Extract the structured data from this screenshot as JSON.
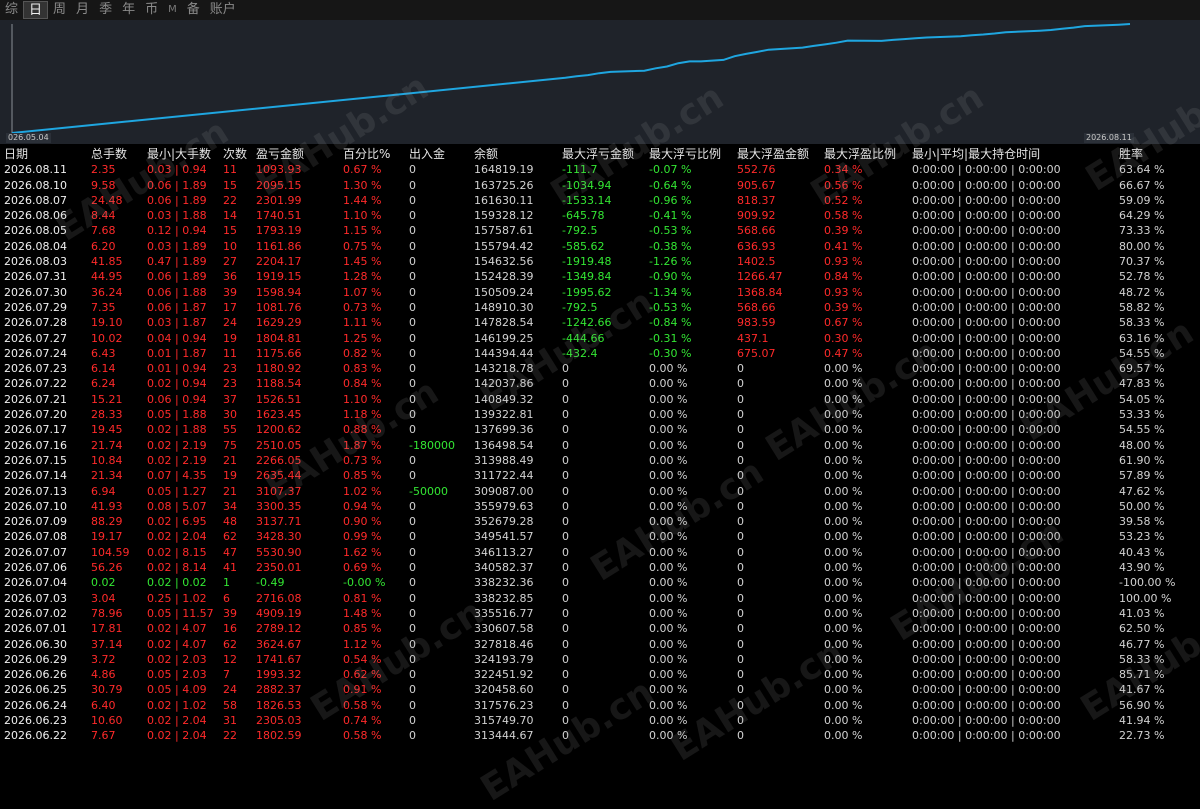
{
  "tabs": [
    "综",
    "日",
    "周",
    "月",
    "季",
    "年",
    "币",
    "M",
    "备",
    "账户"
  ],
  "active_tab": "日",
  "chart": {
    "start_date": "026.05.04",
    "end_date": "2026.08.11",
    "line_color": "#1fa6e0",
    "series": [
      {
        "date": "2026.05.04",
        "balance": 230000
      },
      {
        "date": "2026.06.22",
        "balance": 313444.67
      },
      {
        "date": "2026.06.23",
        "balance": 315749.7
      },
      {
        "date": "2026.06.24",
        "balance": 317576.23
      },
      {
        "date": "2026.06.25",
        "balance": 320458.6
      },
      {
        "date": "2026.06.26",
        "balance": 322451.92
      },
      {
        "date": "2026.06.29",
        "balance": 324193.79
      },
      {
        "date": "2026.06.30",
        "balance": 327818.46
      },
      {
        "date": "2026.07.01",
        "balance": 330607.58
      },
      {
        "date": "2026.07.02",
        "balance": 335516.77
      },
      {
        "date": "2026.07.03",
        "balance": 338232.85
      },
      {
        "date": "2026.07.04",
        "balance": 338232.36
      },
      {
        "date": "2026.07.06",
        "balance": 340582.37
      },
      {
        "date": "2026.07.07",
        "balance": 346113.27
      },
      {
        "date": "2026.07.08",
        "balance": 349541.57
      },
      {
        "date": "2026.07.09",
        "balance": 352679.28
      },
      {
        "date": "2026.07.10",
        "balance": 355979.63
      },
      {
        "date": "2026.07.13",
        "balance": 359087.0
      },
      {
        "date": "2026.07.14",
        "balance": 361722.44
      },
      {
        "date": "2026.07.15",
        "balance": 363988.49
      },
      {
        "date": "2026.07.16",
        "balance": 366498.54
      },
      {
        "date": "2026.07.17",
        "balance": 369699.36
      },
      {
        "date": "2026.07.20",
        "balance": 369322.81
      },
      {
        "date": "2026.07.21",
        "balance": 370849.32
      },
      {
        "date": "2026.07.22",
        "balance": 372037.86
      },
      {
        "date": "2026.07.23",
        "balance": 373218.78
      },
      {
        "date": "2026.07.24",
        "balance": 374394.44
      },
      {
        "date": "2026.07.27",
        "balance": 376199.25
      },
      {
        "date": "2026.07.28",
        "balance": 377828.54
      },
      {
        "date": "2026.07.29",
        "balance": 378910.3
      },
      {
        "date": "2026.07.30",
        "balance": 380509.24
      },
      {
        "date": "2026.07.31",
        "balance": 382428.39
      },
      {
        "date": "2026.08.03",
        "balance": 384632.56
      },
      {
        "date": "2026.08.04",
        "balance": 385794.42
      },
      {
        "date": "2026.08.05",
        "balance": 387587.61
      },
      {
        "date": "2026.08.06",
        "balance": 389328.12
      },
      {
        "date": "2026.08.07",
        "balance": 391630.11
      },
      {
        "date": "2026.08.10",
        "balance": 393725.26
      },
      {
        "date": "2026.08.11",
        "balance": 394819.19
      }
    ]
  },
  "watermark": "EAHub.cn",
  "headers": [
    "日期",
    "总手数",
    "最小|大手数",
    "次数",
    "盈亏金额",
    "百分比%",
    "出入金",
    "余额",
    "最大浮亏金额",
    "最大浮亏比例",
    "最大浮盈金额",
    "最大浮盈比例",
    "最小|平均|最大持仓时间",
    "胜率"
  ],
  "rows": [
    {
      "date": "2026.08.11",
      "lots": "2.35",
      "minmax": "0.03 | 0.94",
      "count": "11",
      "pnl": "1093.93",
      "pct": "0.67 %",
      "flow": "0",
      "balance": "164819.19",
      "maxdd_amt": "-111.7",
      "maxdd_pct": "-0.07 %",
      "maxfp_amt": "552.76",
      "maxfp_pct": "0.34 %",
      "hold": "0:00:00 | 0:00:00 | 0:00:00",
      "win": "63.64 %"
    },
    {
      "date": "2026.08.10",
      "lots": "9.58",
      "minmax": "0.06 | 1.89",
      "count": "15",
      "pnl": "2095.15",
      "pct": "1.30 %",
      "flow": "0",
      "balance": "163725.26",
      "maxdd_amt": "-1034.94",
      "maxdd_pct": "-0.64 %",
      "maxfp_amt": "905.67",
      "maxfp_pct": "0.56 %",
      "hold": "0:00:00 | 0:00:00 | 0:00:00",
      "win": "66.67 %"
    },
    {
      "date": "2026.08.07",
      "lots": "24.48",
      "minmax": "0.06 | 1.89",
      "count": "22",
      "pnl": "2301.99",
      "pct": "1.44 %",
      "flow": "0",
      "balance": "161630.11",
      "maxdd_amt": "-1533.14",
      "maxdd_pct": "-0.96 %",
      "maxfp_amt": "818.37",
      "maxfp_pct": "0.52 %",
      "hold": "0:00:00 | 0:00:00 | 0:00:00",
      "win": "59.09 %"
    },
    {
      "date": "2026.08.06",
      "lots": "8.44",
      "minmax": "0.03 | 1.88",
      "count": "14",
      "pnl": "1740.51",
      "pct": "1.10 %",
      "flow": "0",
      "balance": "159328.12",
      "maxdd_amt": "-645.78",
      "maxdd_pct": "-0.41 %",
      "maxfp_amt": "909.92",
      "maxfp_pct": "0.58 %",
      "hold": "0:00:00 | 0:00:00 | 0:00:00",
      "win": "64.29 %"
    },
    {
      "date": "2026.08.05",
      "lots": "7.68",
      "minmax": "0.12 | 0.94",
      "count": "15",
      "pnl": "1793.19",
      "pct": "1.15 %",
      "flow": "0",
      "balance": "157587.61",
      "maxdd_amt": "-792.5",
      "maxdd_pct": "-0.53 %",
      "maxfp_amt": "568.66",
      "maxfp_pct": "0.39 %",
      "hold": "0:00:00 | 0:00:00 | 0:00:00",
      "win": "73.33 %"
    },
    {
      "date": "2026.08.04",
      "lots": "6.20",
      "minmax": "0.03 | 1.89",
      "count": "10",
      "pnl": "1161.86",
      "pct": "0.75 %",
      "flow": "0",
      "balance": "155794.42",
      "maxdd_amt": "-585.62",
      "maxdd_pct": "-0.38 %",
      "maxfp_amt": "636.93",
      "maxfp_pct": "0.41 %",
      "hold": "0:00:00 | 0:00:00 | 0:00:00",
      "win": "80.00 %"
    },
    {
      "date": "2026.08.03",
      "lots": "41.85",
      "minmax": "0.47 | 1.89",
      "count": "27",
      "pnl": "2204.17",
      "pct": "1.45 %",
      "flow": "0",
      "balance": "154632.56",
      "maxdd_amt": "-1919.48",
      "maxdd_pct": "-1.26 %",
      "maxfp_amt": "1402.5",
      "maxfp_pct": "0.93 %",
      "hold": "0:00:00 | 0:00:00 | 0:00:00",
      "win": "70.37 %"
    },
    {
      "date": "2026.07.31",
      "lots": "44.95",
      "minmax": "0.06 | 1.89",
      "count": "36",
      "pnl": "1919.15",
      "pct": "1.28 %",
      "flow": "0",
      "balance": "152428.39",
      "maxdd_amt": "-1349.84",
      "maxdd_pct": "-0.90 %",
      "maxfp_amt": "1266.47",
      "maxfp_pct": "0.84 %",
      "hold": "0:00:00 | 0:00:00 | 0:00:00",
      "win": "52.78 %"
    },
    {
      "date": "2026.07.30",
      "lots": "36.24",
      "minmax": "0.06 | 1.88",
      "count": "39",
      "pnl": "1598.94",
      "pct": "1.07 %",
      "flow": "0",
      "balance": "150509.24",
      "maxdd_amt": "-1995.62",
      "maxdd_pct": "-1.34 %",
      "maxfp_amt": "1368.84",
      "maxfp_pct": "0.93 %",
      "hold": "0:00:00 | 0:00:00 | 0:00:00",
      "win": "48.72 %"
    },
    {
      "date": "2026.07.29",
      "lots": "7.35",
      "minmax": "0.06 | 1.87",
      "count": "17",
      "pnl": "1081.76",
      "pct": "0.73 %",
      "flow": "0",
      "balance": "148910.30",
      "maxdd_amt": "-792.5",
      "maxdd_pct": "-0.53 %",
      "maxfp_amt": "568.66",
      "maxfp_pct": "0.39 %",
      "hold": "0:00:00 | 0:00:00 | 0:00:00",
      "win": "58.82 %"
    },
    {
      "date": "2026.07.28",
      "lots": "19.10",
      "minmax": "0.03 | 1.87",
      "count": "24",
      "pnl": "1629.29",
      "pct": "1.11 %",
      "flow": "0",
      "balance": "147828.54",
      "maxdd_amt": "-1242.66",
      "maxdd_pct": "-0.84 %",
      "maxfp_amt": "983.59",
      "maxfp_pct": "0.67 %",
      "hold": "0:00:00 | 0:00:00 | 0:00:00",
      "win": "58.33 %"
    },
    {
      "date": "2026.07.27",
      "lots": "10.02",
      "minmax": "0.04 | 0.94",
      "count": "19",
      "pnl": "1804.81",
      "pct": "1.25 %",
      "flow": "0",
      "balance": "146199.25",
      "maxdd_amt": "-444.66",
      "maxdd_pct": "-0.31 %",
      "maxfp_amt": "437.1",
      "maxfp_pct": "0.30 %",
      "hold": "0:00:00 | 0:00:00 | 0:00:00",
      "win": "63.16 %"
    },
    {
      "date": "2026.07.24",
      "lots": "6.43",
      "minmax": "0.01 | 1.87",
      "count": "11",
      "pnl": "1175.66",
      "pct": "0.82 %",
      "flow": "0",
      "balance": "144394.44",
      "maxdd_amt": "-432.4",
      "maxdd_pct": "-0.30 %",
      "maxfp_amt": "675.07",
      "maxfp_pct": "0.47 %",
      "hold": "0:00:00 | 0:00:00 | 0:00:00",
      "win": "54.55 %"
    },
    {
      "date": "2026.07.23",
      "lots": "6.14",
      "minmax": "0.01 | 0.94",
      "count": "23",
      "pnl": "1180.92",
      "pct": "0.83 %",
      "flow": "0",
      "balance": "143218.78",
      "maxdd_amt": "0",
      "maxdd_pct": "0.00 %",
      "maxfp_amt": "0",
      "maxfp_pct": "0.00 %",
      "hold": "0:00:00 | 0:00:00 | 0:00:00",
      "win": "69.57 %"
    },
    {
      "date": "2026.07.22",
      "lots": "6.24",
      "minmax": "0.02 | 0.94",
      "count": "23",
      "pnl": "1188.54",
      "pct": "0.84 %",
      "flow": "0",
      "balance": "142037.86",
      "maxdd_amt": "0",
      "maxdd_pct": "0.00 %",
      "maxfp_amt": "0",
      "maxfp_pct": "0.00 %",
      "hold": "0:00:00 | 0:00:00 | 0:00:00",
      "win": "47.83 %"
    },
    {
      "date": "2026.07.21",
      "lots": "15.21",
      "minmax": "0.06 | 0.94",
      "count": "37",
      "pnl": "1526.51",
      "pct": "1.10 %",
      "flow": "0",
      "balance": "140849.32",
      "maxdd_amt": "0",
      "maxdd_pct": "0.00 %",
      "maxfp_amt": "0",
      "maxfp_pct": "0.00 %",
      "hold": "0:00:00 | 0:00:00 | 0:00:00",
      "win": "54.05 %"
    },
    {
      "date": "2026.07.20",
      "lots": "28.33",
      "minmax": "0.05 | 1.88",
      "count": "30",
      "pnl": "1623.45",
      "pct": "1.18 %",
      "flow": "0",
      "balance": "139322.81",
      "maxdd_amt": "0",
      "maxdd_pct": "0.00 %",
      "maxfp_amt": "0",
      "maxfp_pct": "0.00 %",
      "hold": "0:00:00 | 0:00:00 | 0:00:00",
      "win": "53.33 %"
    },
    {
      "date": "2026.07.17",
      "lots": "19.45",
      "minmax": "0.02 | 1.88",
      "count": "55",
      "pnl": "1200.62",
      "pct": "0.88 %",
      "flow": "0",
      "balance": "137699.36",
      "maxdd_amt": "0",
      "maxdd_pct": "0.00 %",
      "maxfp_amt": "0",
      "maxfp_pct": "0.00 %",
      "hold": "0:00:00 | 0:00:00 | 0:00:00",
      "win": "54.55 %"
    },
    {
      "date": "2026.07.16",
      "lots": "21.74",
      "minmax": "0.02 | 2.19",
      "count": "75",
      "pnl": "2510.05",
      "pct": "1.87 %",
      "flow": "-180000",
      "balance": "136498.54",
      "maxdd_amt": "0",
      "maxdd_pct": "0.00 %",
      "maxfp_amt": "0",
      "maxfp_pct": "0.00 %",
      "hold": "0:00:00 | 0:00:00 | 0:00:00",
      "win": "48.00 %"
    },
    {
      "date": "2026.07.15",
      "lots": "10.84",
      "minmax": "0.02 | 2.19",
      "count": "21",
      "pnl": "2266.05",
      "pct": "0.73 %",
      "flow": "0",
      "balance": "313988.49",
      "maxdd_amt": "0",
      "maxdd_pct": "0.00 %",
      "maxfp_amt": "0",
      "maxfp_pct": "0.00 %",
      "hold": "0:00:00 | 0:00:00 | 0:00:00",
      "win": "61.90 %"
    },
    {
      "date": "2026.07.14",
      "lots": "21.34",
      "minmax": "0.07 | 4.35",
      "count": "19",
      "pnl": "2635.44",
      "pct": "0.85 %",
      "flow": "0",
      "balance": "311722.44",
      "maxdd_amt": "0",
      "maxdd_pct": "0.00 %",
      "maxfp_amt": "0",
      "maxfp_pct": "0.00 %",
      "hold": "0:00:00 | 0:00:00 | 0:00:00",
      "win": "57.89 %"
    },
    {
      "date": "2026.07.13",
      "lots": "6.94",
      "minmax": "0.05 | 1.27",
      "count": "21",
      "pnl": "3107.37",
      "pct": "1.02 %",
      "flow": "-50000",
      "balance": "309087.00",
      "maxdd_amt": "0",
      "maxdd_pct": "0.00 %",
      "maxfp_amt": "0",
      "maxfp_pct": "0.00 %",
      "hold": "0:00:00 | 0:00:00 | 0:00:00",
      "win": "47.62 %"
    },
    {
      "date": "2026.07.10",
      "lots": "41.93",
      "minmax": "0.08 | 5.07",
      "count": "34",
      "pnl": "3300.35",
      "pct": "0.94 %",
      "flow": "0",
      "balance": "355979.63",
      "maxdd_amt": "0",
      "maxdd_pct": "0.00 %",
      "maxfp_amt": "0",
      "maxfp_pct": "0.00 %",
      "hold": "0:00:00 | 0:00:00 | 0:00:00",
      "win": "50.00 %"
    },
    {
      "date": "2026.07.09",
      "lots": "88.29",
      "minmax": "0.02 | 6.95",
      "count": "48",
      "pnl": "3137.71",
      "pct": "0.90 %",
      "flow": "0",
      "balance": "352679.28",
      "maxdd_amt": "0",
      "maxdd_pct": "0.00 %",
      "maxfp_amt": "0",
      "maxfp_pct": "0.00 %",
      "hold": "0:00:00 | 0:00:00 | 0:00:00",
      "win": "39.58 %"
    },
    {
      "date": "2026.07.08",
      "lots": "19.17",
      "minmax": "0.02 | 2.04",
      "count": "62",
      "pnl": "3428.30",
      "pct": "0.99 %",
      "flow": "0",
      "balance": "349541.57",
      "maxdd_amt": "0",
      "maxdd_pct": "0.00 %",
      "maxfp_amt": "0",
      "maxfp_pct": "0.00 %",
      "hold": "0:00:00 | 0:00:00 | 0:00:00",
      "win": "53.23 %"
    },
    {
      "date": "2026.07.07",
      "lots": "104.59",
      "minmax": "0.02 | 8.15",
      "count": "47",
      "pnl": "5530.90",
      "pct": "1.62 %",
      "flow": "0",
      "balance": "346113.27",
      "maxdd_amt": "0",
      "maxdd_pct": "0.00 %",
      "maxfp_amt": "0",
      "maxfp_pct": "0.00 %",
      "hold": "0:00:00 | 0:00:00 | 0:00:00",
      "win": "40.43 %"
    },
    {
      "date": "2026.07.06",
      "lots": "56.26",
      "minmax": "0.02 | 8.14",
      "count": "41",
      "pnl": "2350.01",
      "pct": "0.69 %",
      "flow": "0",
      "balance": "340582.37",
      "maxdd_amt": "0",
      "maxdd_pct": "0.00 %",
      "maxfp_amt": "0",
      "maxfp_pct": "0.00 %",
      "hold": "0:00:00 | 0:00:00 | 0:00:00",
      "win": "43.90 %"
    },
    {
      "date": "2026.07.04",
      "lots": "0.02",
      "minmax": "0.02 | 0.02",
      "count": "1",
      "pnl": "-0.49",
      "pct": "-0.00 %",
      "flow": "0",
      "balance": "338232.36",
      "maxdd_amt": "0",
      "maxdd_pct": "0.00 %",
      "maxfp_amt": "0",
      "maxfp_pct": "0.00 %",
      "hold": "0:00:00 | 0:00:00 | 0:00:00",
      "win": "-100.00 %"
    },
    {
      "date": "2026.07.03",
      "lots": "3.04",
      "minmax": "0.25 | 1.02",
      "count": "6",
      "pnl": "2716.08",
      "pct": "0.81 %",
      "flow": "0",
      "balance": "338232.85",
      "maxdd_amt": "0",
      "maxdd_pct": "0.00 %",
      "maxfp_amt": "0",
      "maxfp_pct": "0.00 %",
      "hold": "0:00:00 | 0:00:00 | 0:00:00",
      "win": "100.00 %"
    },
    {
      "date": "2026.07.02",
      "lots": "78.96",
      "minmax": "0.05 | 11.57",
      "count": "39",
      "pnl": "4909.19",
      "pct": "1.48 %",
      "flow": "0",
      "balance": "335516.77",
      "maxdd_amt": "0",
      "maxdd_pct": "0.00 %",
      "maxfp_amt": "0",
      "maxfp_pct": "0.00 %",
      "hold": "0:00:00 | 0:00:00 | 0:00:00",
      "win": "41.03 %"
    },
    {
      "date": "2026.07.01",
      "lots": "17.81",
      "minmax": "0.02 | 4.07",
      "count": "16",
      "pnl": "2789.12",
      "pct": "0.85 %",
      "flow": "0",
      "balance": "330607.58",
      "maxdd_amt": "0",
      "maxdd_pct": "0.00 %",
      "maxfp_amt": "0",
      "maxfp_pct": "0.00 %",
      "hold": "0:00:00 | 0:00:00 | 0:00:00",
      "win": "62.50 %"
    },
    {
      "date": "2026.06.30",
      "lots": "37.14",
      "minmax": "0.02 | 4.07",
      "count": "62",
      "pnl": "3624.67",
      "pct": "1.12 %",
      "flow": "0",
      "balance": "327818.46",
      "maxdd_amt": "0",
      "maxdd_pct": "0.00 %",
      "maxfp_amt": "0",
      "maxfp_pct": "0.00 %",
      "hold": "0:00:00 | 0:00:00 | 0:00:00",
      "win": "46.77 %"
    },
    {
      "date": "2026.06.29",
      "lots": "3.72",
      "minmax": "0.02 | 2.03",
      "count": "12",
      "pnl": "1741.67",
      "pct": "0.54 %",
      "flow": "0",
      "balance": "324193.79",
      "maxdd_amt": "0",
      "maxdd_pct": "0.00 %",
      "maxfp_amt": "0",
      "maxfp_pct": "0.00 %",
      "hold": "0:00:00 | 0:00:00 | 0:00:00",
      "win": "58.33 %"
    },
    {
      "date": "2026.06.26",
      "lots": "4.86",
      "minmax": "0.05 | 2.03",
      "count": "7",
      "pnl": "1993.32",
      "pct": "0.62 %",
      "flow": "0",
      "balance": "322451.92",
      "maxdd_amt": "0",
      "maxdd_pct": "0.00 %",
      "maxfp_amt": "0",
      "maxfp_pct": "0.00 %",
      "hold": "0:00:00 | 0:00:00 | 0:00:00",
      "win": "85.71 %"
    },
    {
      "date": "2026.06.25",
      "lots": "30.79",
      "minmax": "0.05 | 4.09",
      "count": "24",
      "pnl": "2882.37",
      "pct": "0.91 %",
      "flow": "0",
      "balance": "320458.60",
      "maxdd_amt": "0",
      "maxdd_pct": "0.00 %",
      "maxfp_amt": "0",
      "maxfp_pct": "0.00 %",
      "hold": "0:00:00 | 0:00:00 | 0:00:00",
      "win": "41.67 %"
    },
    {
      "date": "2026.06.24",
      "lots": "6.40",
      "minmax": "0.02 | 1.02",
      "count": "58",
      "pnl": "1826.53",
      "pct": "0.58 %",
      "flow": "0",
      "balance": "317576.23",
      "maxdd_amt": "0",
      "maxdd_pct": "0.00 %",
      "maxfp_amt": "0",
      "maxfp_pct": "0.00 %",
      "hold": "0:00:00 | 0:00:00 | 0:00:00",
      "win": "56.90 %"
    },
    {
      "date": "2026.06.23",
      "lots": "10.60",
      "minmax": "0.02 | 2.04",
      "count": "31",
      "pnl": "2305.03",
      "pct": "0.74 %",
      "flow": "0",
      "balance": "315749.70",
      "maxdd_amt": "0",
      "maxdd_pct": "0.00 %",
      "maxfp_amt": "0",
      "maxfp_pct": "0.00 %",
      "hold": "0:00:00 | 0:00:00 | 0:00:00",
      "win": "41.94 %"
    },
    {
      "date": "2026.06.22",
      "lots": "7.67",
      "minmax": "0.02 | 2.04",
      "count": "22",
      "pnl": "1802.59",
      "pct": "0.58 %",
      "flow": "0",
      "balance": "313444.67",
      "maxdd_amt": "0",
      "maxdd_pct": "0.00 %",
      "maxfp_amt": "0",
      "maxfp_pct": "0.00 %",
      "hold": "0:00:00 | 0:00:00 | 0:00:00",
      "win": "22.73 %"
    }
  ]
}
